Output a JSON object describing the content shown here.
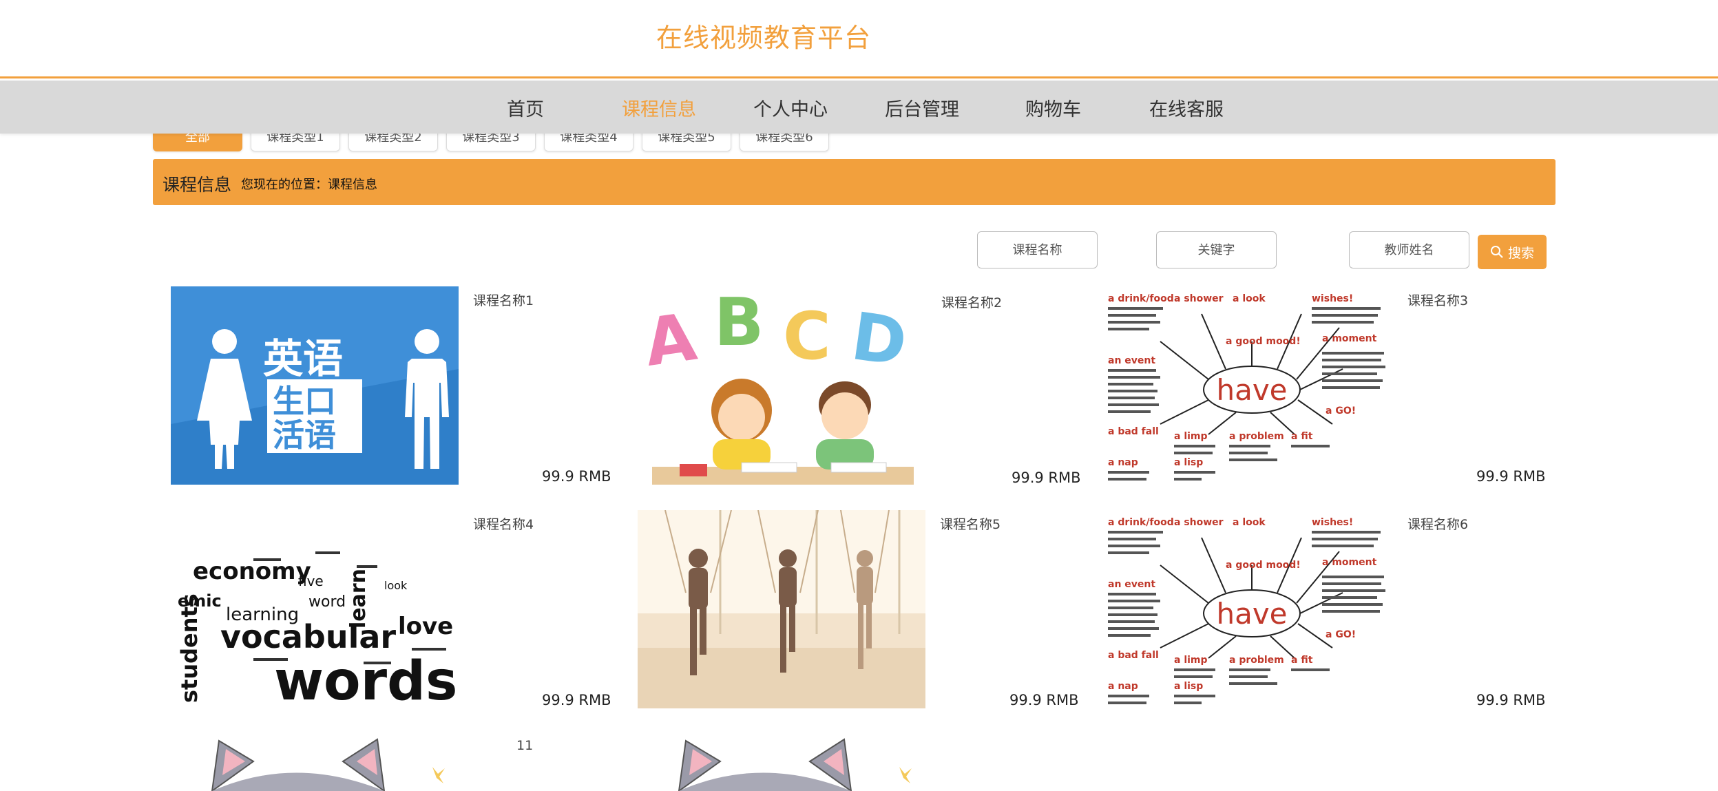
{
  "header": {
    "title": "在线视频教育平台"
  },
  "nav": {
    "items": [
      {
        "label": "首页"
      },
      {
        "label": "课程信息"
      },
      {
        "label": "个人中心"
      },
      {
        "label": "后台管理"
      },
      {
        "label": "购物车"
      },
      {
        "label": "在线客服"
      }
    ],
    "active": "课程信息"
  },
  "type_tabs": [
    "全部",
    "课程类型1",
    "课程类型2",
    "课程类型3",
    "课程类型4",
    "课程类型5",
    "课程类型6"
  ],
  "position_bar": {
    "title": "课程信息",
    "location": "您现在的位置：课程信息"
  },
  "search": {
    "course_name_placeholder": "课程名称",
    "keyword_placeholder": "关键字",
    "teacher_placeholder": "教师姓名",
    "button_label": "搜索"
  },
  "courses": [
    {
      "name": "课程名称1",
      "price": "99.9 RMB",
      "image": "english-spoken-sign"
    },
    {
      "name": "课程名称2",
      "price": "99.9 RMB",
      "image": "abcd-kids"
    },
    {
      "name": "课程名称3",
      "price": "99.9 RMB",
      "image": "have-mindmap"
    },
    {
      "name": "课程名称4",
      "price": "99.9 RMB",
      "image": "vocabulary-word-cloud"
    },
    {
      "name": "课程名称5",
      "price": "99.9 RMB",
      "image": "yoga-class"
    },
    {
      "name": "课程名称6",
      "price": "99.9 RMB",
      "image": "have-mindmap"
    },
    {
      "name": "11",
      "price": "",
      "image": "cat-drawing"
    },
    {
      "name": "",
      "price": "",
      "image": "cat-drawing"
    }
  ],
  "image_text": {
    "english_sign": [
      "英语",
      "生口",
      "活语"
    ],
    "abcd": [
      "A",
      "B",
      "C",
      "D"
    ],
    "have": "have",
    "vocab": [
      "words",
      "vocabular",
      "economy",
      "learning",
      "students",
      "love"
    ]
  },
  "colors": {
    "accent": "#f2a03d",
    "nav_bg": "#d9d9d9",
    "sign_blue": "#3f8fd8"
  }
}
